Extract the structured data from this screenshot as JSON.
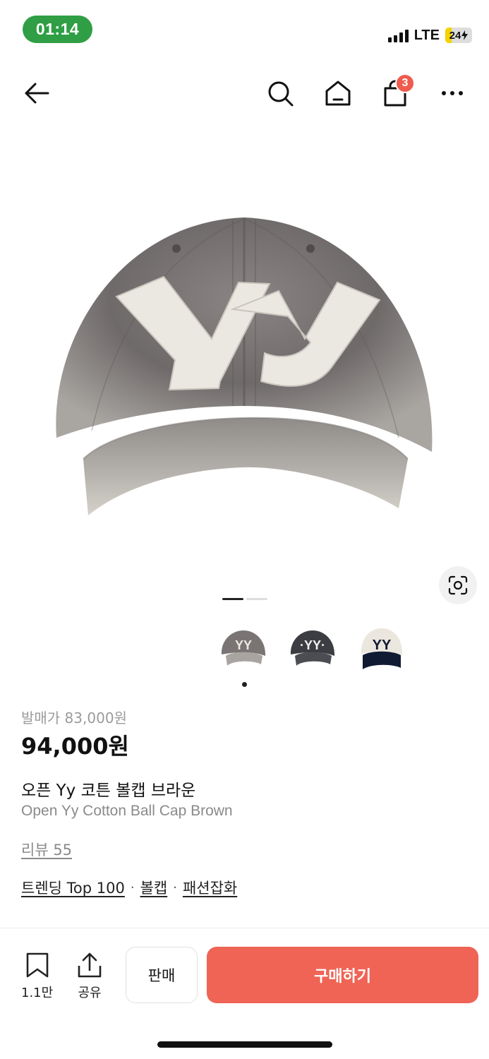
{
  "status_bar": {
    "time": "01:14",
    "network": "LTE",
    "battery": "24"
  },
  "nav": {
    "cart_count": "3"
  },
  "product": {
    "original_price": "발매가 83,000원",
    "price": "94,000원",
    "name_ko": "오픈 Yy 코튼 볼캡 브라운",
    "name_en": "Open Yy Cotton Ball Cap Brown",
    "review": "리뷰 55",
    "tags": [
      "트렌딩 Top 100",
      "볼캡",
      "패션잡화"
    ]
  },
  "gallery": {
    "pages": 2,
    "active_page": 1,
    "variants": [
      "brown",
      "charcoal",
      "navy-cream"
    ]
  },
  "bottom_bar": {
    "bookmark_count": "1.1만",
    "share_label": "공유",
    "sell_label": "판매",
    "buy_label": "구매하기"
  },
  "colors": {
    "accent": "#ef6455",
    "badge": "#ef5b4d",
    "time_pill": "#2f9e44"
  }
}
